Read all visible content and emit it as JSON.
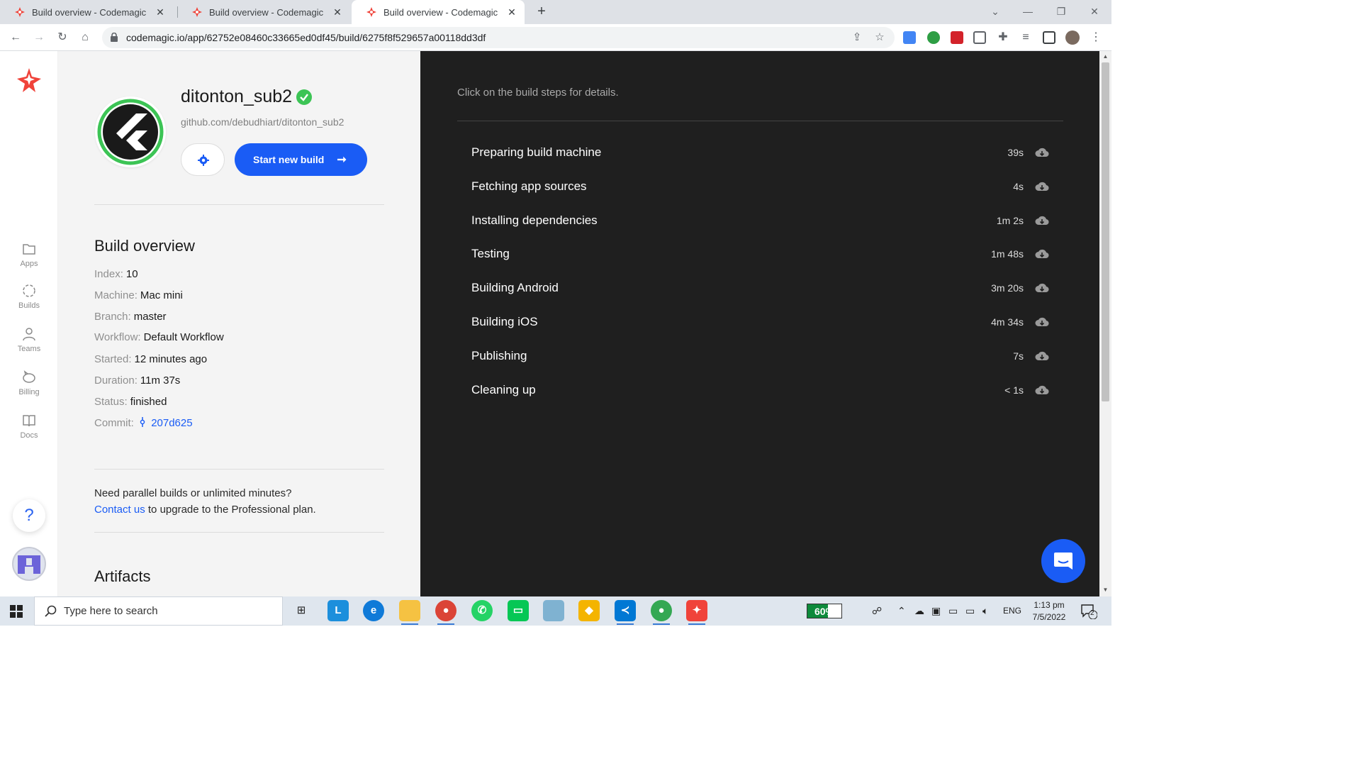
{
  "browser": {
    "tabs": [
      {
        "title": "Build overview - Codemagic",
        "active": false
      },
      {
        "title": "Build overview - Codemagic",
        "active": false
      },
      {
        "title": "Build overview - Codemagic",
        "active": true
      }
    ],
    "close_glyph": "✕",
    "new_tab_glyph": "+",
    "url": "codemagic.io/app/62752e08460c33665ed0df45/build/6275f8f529657a00118dd3df"
  },
  "rail": {
    "items": [
      {
        "label": "Apps",
        "icon": "folder-icon"
      },
      {
        "label": "Builds",
        "icon": "builds-icon"
      },
      {
        "label": "Teams",
        "icon": "person-icon"
      },
      {
        "label": "Billing",
        "icon": "piggy-bank-icon"
      },
      {
        "label": "Docs",
        "icon": "book-icon"
      }
    ],
    "help_label": "?"
  },
  "app": {
    "name": "ditonton_sub2",
    "repo": "github.com/debudhiart/ditonton_sub2",
    "start_build_label": "Start new build",
    "start_build_arrow": "➞"
  },
  "overview": {
    "title": "Build overview",
    "fields": [
      {
        "key": "Index:",
        "value": "10"
      },
      {
        "key": "Machine:",
        "value": "Mac mini"
      },
      {
        "key": "Branch:",
        "value": "master"
      },
      {
        "key": "Workflow:",
        "value": "Default Workflow"
      },
      {
        "key": "Started:",
        "value": "12 minutes ago"
      },
      {
        "key": "Duration:",
        "value": "11m 37s"
      },
      {
        "key": "Status:",
        "value": "finished"
      },
      {
        "key": "Commit:",
        "value": "207d625"
      }
    ]
  },
  "upgrade": {
    "line1": "Need parallel builds or unlimited minutes?",
    "link": "Contact us",
    "line2": " to upgrade to the Professional plan."
  },
  "artifacts_title": "Artifacts",
  "log": {
    "hint": "Click on the build steps for details.",
    "steps": [
      {
        "name": "Preparing build machine",
        "duration": "39s"
      },
      {
        "name": "Fetching app sources",
        "duration": "4s"
      },
      {
        "name": "Installing dependencies",
        "duration": "1m 2s"
      },
      {
        "name": "Testing",
        "duration": "1m 48s"
      },
      {
        "name": "Building Android",
        "duration": "3m 20s"
      },
      {
        "name": "Building iOS",
        "duration": "4m 34s"
      },
      {
        "name": "Publishing",
        "duration": "7s"
      },
      {
        "name": "Cleaning up",
        "duration": "< 1s"
      }
    ]
  },
  "taskbar": {
    "search_placeholder": "Type here to search",
    "battery_percent": "60%",
    "battery_level": 0.6,
    "language": "ENG",
    "time": "1:13 pm",
    "date": "7/5/2022",
    "notification_count": "2"
  },
  "colors": {
    "accent": "#1a5cf5",
    "log_bg": "#1f1f1f",
    "success": "#3cc455",
    "codemagic_red": "#f0433a"
  }
}
